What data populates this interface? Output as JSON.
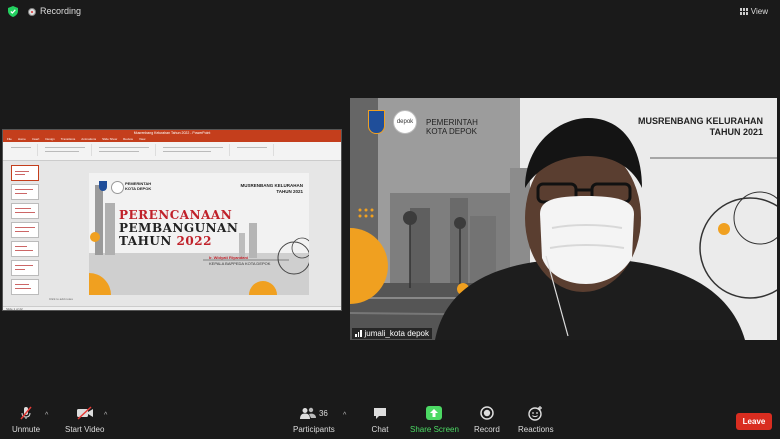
{
  "topbar": {
    "recording_label": "Recording",
    "view_label": "View"
  },
  "share": {
    "app_title": "Musrenbang Kelurahan Tahun 2022 - PowerPoint",
    "tabs": [
      "File",
      "Home",
      "Insert",
      "Design",
      "Transitions",
      "Animations",
      "Slide Show",
      "Review",
      "View"
    ],
    "notes_placeholder": "Click to add notes",
    "status_text": "Slide 1 of 22",
    "slide": {
      "gov_line1": "PEMERINTAH",
      "gov_line2": "KOTA DEPOK",
      "event_line1": "MUSRENBANG KELURAHAN",
      "event_line2": "TAHUN 2021",
      "title_line1": "PERENCANAAN",
      "title_line2": "PEMBANGUNAN",
      "title_line3_a": "TAHUN",
      "title_line3_b": "2022",
      "presenter": "Ir. Widyati Riyandani",
      "presenter_role": "KEPALA BAPPEDA KOTA DEPOK"
    }
  },
  "camera": {
    "name": "jumali_kota depok",
    "bg_gov_line1": "PEMERINTAH",
    "bg_gov_line2": "KOTA DEPOK",
    "bg_event_line1": "MUSRENBANG KELURAHAN",
    "bg_event_line2": "TAHUN 2021",
    "depok_badge": "depok"
  },
  "toolbar": {
    "unmute": "Unmute",
    "start_video": "Start Video",
    "participants": "Participants",
    "participants_count": "36",
    "chat": "Chat",
    "share_screen": "Share Screen",
    "record": "Record",
    "reactions": "Reactions",
    "leave": "Leave"
  },
  "colors": {
    "accent_green": "#4cd964",
    "leave_red": "#d92d20",
    "slide_orange": "#f0a020",
    "slide_red": "#c0212a"
  }
}
